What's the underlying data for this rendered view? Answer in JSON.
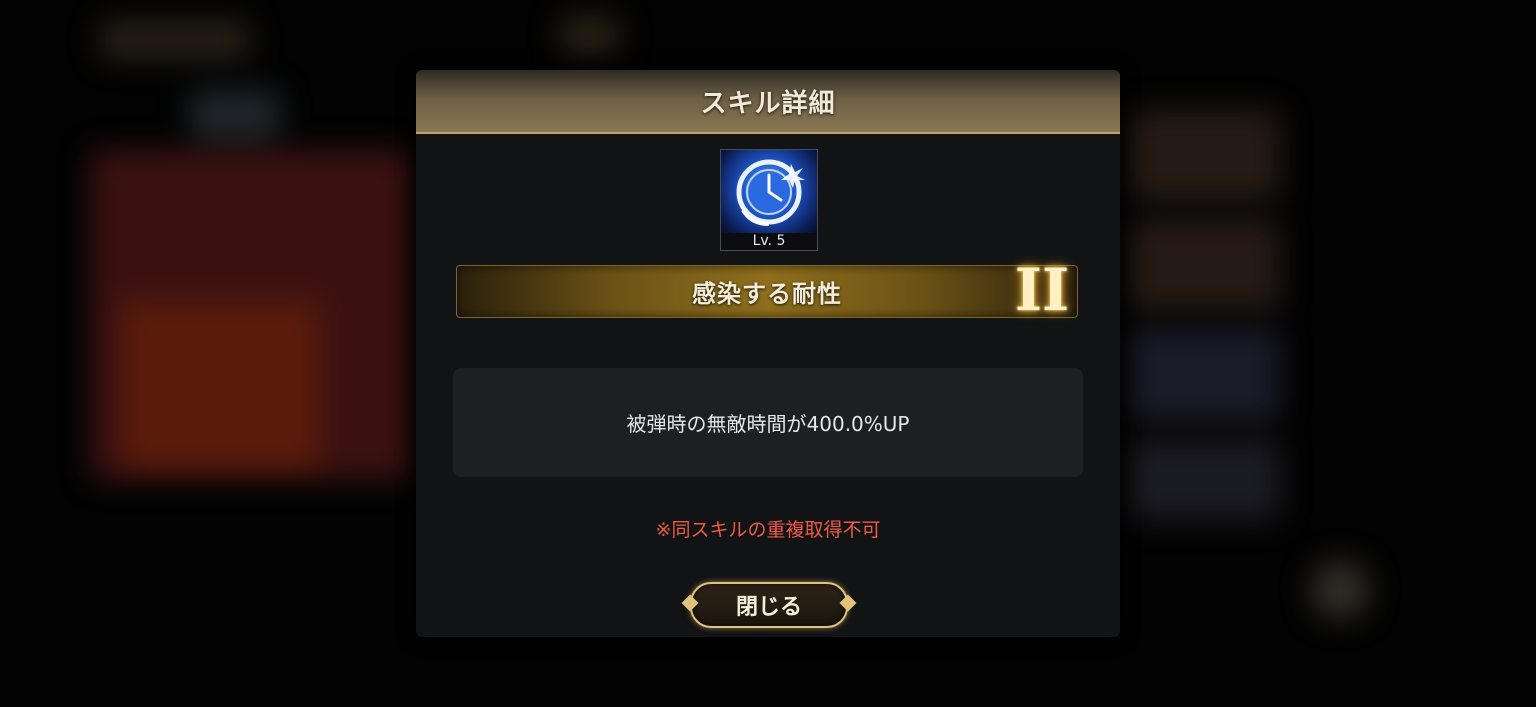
{
  "dialog": {
    "title": "スキル詳細"
  },
  "skill": {
    "level_label": "Lv. 5",
    "icon": "clock-icon",
    "name": "感染する耐性",
    "rank": "II",
    "description": "被弾時の無敵時間が400.0%UP",
    "note": "※同スキルの重複取得不可"
  },
  "buttons": {
    "close_label": "閉じる"
  },
  "colors": {
    "header_gold": "#8a7753",
    "note_red": "#ef5a45",
    "icon_blue": "#1f56c9"
  }
}
